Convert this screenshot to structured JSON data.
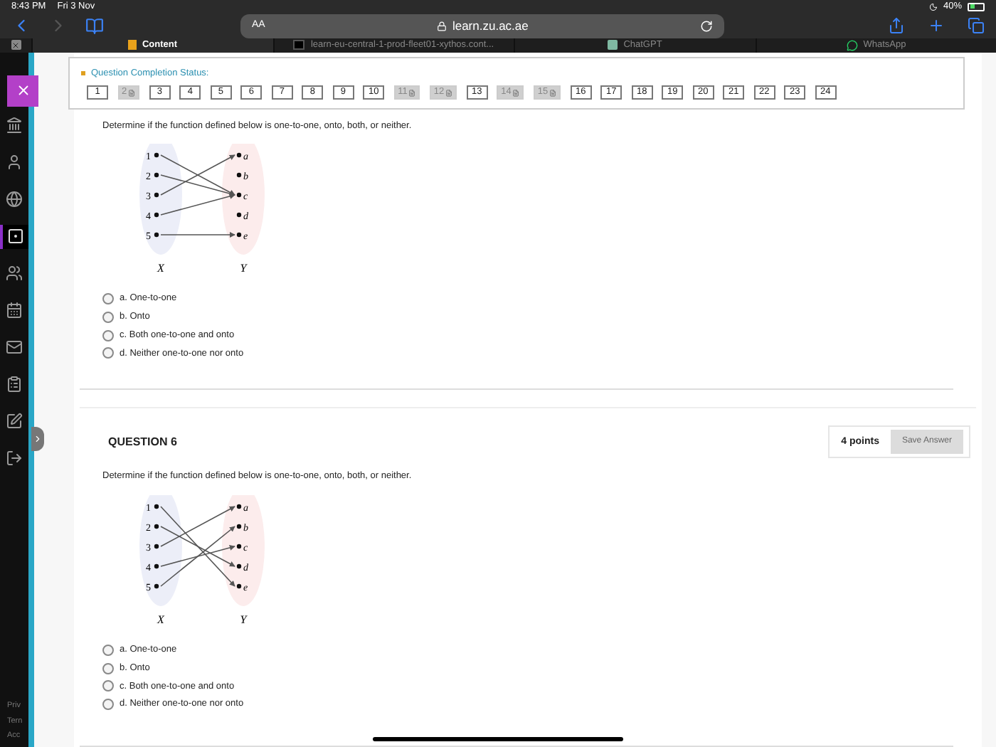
{
  "status_bar": {
    "time": "8:43 PM",
    "date": "Fri 3 Nov",
    "battery": "40%"
  },
  "browser": {
    "text_size": "AA",
    "url": "learn.zu.ac.ae",
    "back_enabled": true,
    "forward_enabled": false
  },
  "browser_tabs": [
    {
      "label": "Content",
      "selected": true
    },
    {
      "label": "learn-eu-central-1-prod-fleet01-xythos.cont...",
      "selected": false
    },
    {
      "label": "ChatGPT",
      "selected": false
    },
    {
      "label": "WhatsApp",
      "selected": false
    }
  ],
  "sidebar": {
    "items": [
      {
        "kind": "institution",
        "selected": false
      },
      {
        "kind": "profile",
        "selected": false
      },
      {
        "kind": "globe",
        "selected": false
      },
      {
        "kind": "content",
        "selected": true
      },
      {
        "kind": "groups",
        "selected": false
      },
      {
        "kind": "calendar",
        "selected": false
      },
      {
        "kind": "messages",
        "selected": false
      },
      {
        "kind": "grades",
        "selected": false
      },
      {
        "kind": "edit",
        "selected": false
      },
      {
        "kind": "logout",
        "selected": false
      }
    ],
    "footer_links": [
      "Priv",
      "Tern",
      "Acc"
    ]
  },
  "completion_status": {
    "title": "Question Completion Status:",
    "questions": [
      {
        "label": "1",
        "answered": false
      },
      {
        "label": "2",
        "answered": true
      },
      {
        "label": "3",
        "answered": false
      },
      {
        "label": "4",
        "answered": false
      },
      {
        "label": "5",
        "answered": false
      },
      {
        "label": "6",
        "answered": false
      },
      {
        "label": "7",
        "answered": false
      },
      {
        "label": "8",
        "answered": false
      },
      {
        "label": "9",
        "answered": false
      },
      {
        "label": "10",
        "answered": false
      },
      {
        "label": "11",
        "answered": true
      },
      {
        "label": "12",
        "answered": true
      },
      {
        "label": "13",
        "answered": false
      },
      {
        "label": "14",
        "answered": true
      },
      {
        "label": "15",
        "answered": true
      },
      {
        "label": "16",
        "answered": false
      },
      {
        "label": "17",
        "answered": false
      },
      {
        "label": "18",
        "answered": false
      },
      {
        "label": "19",
        "answered": false
      },
      {
        "label": "20",
        "answered": false
      },
      {
        "label": "21",
        "answered": false
      },
      {
        "label": "22",
        "answered": false
      },
      {
        "label": "23",
        "answered": false
      },
      {
        "label": "24",
        "answered": false
      }
    ]
  },
  "questions": [
    {
      "prompt": "Determine if the function defined below is one-to-one, onto, both, or neither.",
      "diagram": {
        "domain_label": "X",
        "codomain_label": "Y",
        "domain": [
          "1",
          "2",
          "3",
          "4",
          "5"
        ],
        "codomain": [
          "a",
          "b",
          "c",
          "d",
          "e"
        ]
      },
      "options": [
        {
          "label": "a. One-to-one",
          "selected": false
        },
        {
          "label": "b. Onto",
          "selected": false
        },
        {
          "label": "c. Both one-to-one and onto",
          "selected": false
        },
        {
          "label": "d. Neither one-to-one nor onto",
          "selected": false
        }
      ]
    },
    {
      "title": "QUESTION 6",
      "points": "4 points",
      "save_label": "Save Answer",
      "prompt": "Determine if the function defined below is one-to-one, onto, both, or neither.",
      "diagram": {
        "domain_label": "X",
        "codomain_label": "Y",
        "domain": [
          "1",
          "2",
          "3",
          "4",
          "5"
        ],
        "codomain": [
          "a",
          "b",
          "c",
          "d",
          "e"
        ]
      },
      "options": [
        {
          "label": "a. One-to-one",
          "selected": false
        },
        {
          "label": "b. Onto",
          "selected": false
        },
        {
          "label": "c. Both one-to-one and onto",
          "selected": false
        },
        {
          "label": "d. Neither one-to-one nor onto",
          "selected": false
        }
      ]
    }
  ]
}
